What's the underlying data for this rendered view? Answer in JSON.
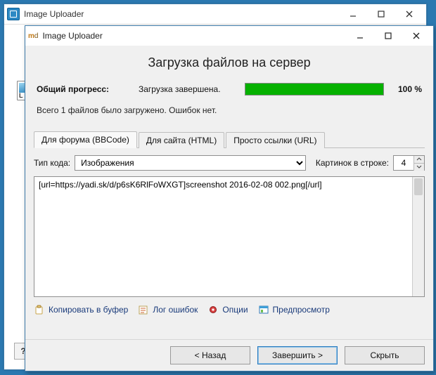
{
  "parent": {
    "title": "Image Uploader"
  },
  "dialog": {
    "title": "Image Uploader",
    "heading": "Загрузка файлов на сервер",
    "progress_label": "Общий прогресс:",
    "progress_status": "Загрузка завершена.",
    "progress_percent": "100 %",
    "summary": "Всего 1 файлов было загружено. Ошибок нет."
  },
  "tabs": [
    {
      "label": "Для форума (BBCode)"
    },
    {
      "label": "Для сайта (HTML)"
    },
    {
      "label": "Просто ссылки (URL)"
    }
  ],
  "code_type_label": "Тип кода:",
  "code_type_value": "Изображения",
  "pics_per_row_label": "Картинок в строке:",
  "pics_per_row_value": "4",
  "output_text": "[url=https://yadi.sk/d/p6sK6RlFoWXGT]screenshot 2016-02-08 002.png[/url]",
  "toolbar": {
    "copy": "Копировать в буфер",
    "log": "Лог ошибок",
    "options": "Опции",
    "preview": "Предпросмотр"
  },
  "actions": {
    "back": "< Назад",
    "finish": "Завершить >",
    "hide": "Скрыть"
  },
  "help_q": "?"
}
